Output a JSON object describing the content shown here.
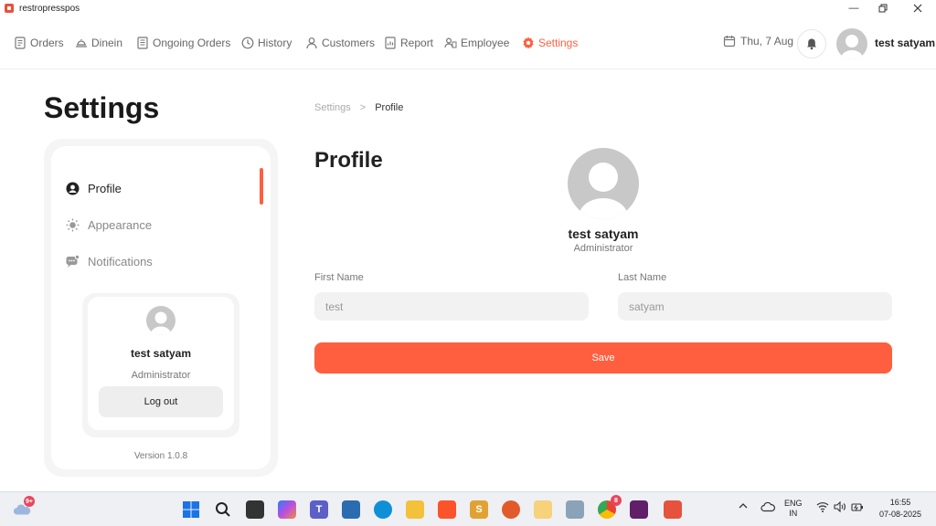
{
  "window": {
    "title": "restropresspos"
  },
  "nav": {
    "items": [
      {
        "label": "Orders",
        "icon": "orders-icon"
      },
      {
        "label": "Dinein",
        "icon": "dinein-icon"
      },
      {
        "label": "Ongoing Orders",
        "icon": "ongoing-orders-icon"
      },
      {
        "label": "History",
        "icon": "history-icon"
      },
      {
        "label": "Customers",
        "icon": "customers-icon"
      },
      {
        "label": "Report",
        "icon": "report-icon"
      },
      {
        "label": "Employee",
        "icon": "employee-icon"
      },
      {
        "label": "Settings",
        "icon": "gear-icon",
        "active": true
      }
    ],
    "date": "Thu, 7 Aug",
    "username": "test satyam"
  },
  "page": {
    "title": "Settings",
    "breadcrumb": {
      "parent": "Settings",
      "separator": ">",
      "current": "Profile"
    }
  },
  "sidebar": {
    "items": [
      {
        "label": "Profile",
        "icon": "user-circle-icon",
        "active": true
      },
      {
        "label": "Appearance",
        "icon": "sun-icon"
      },
      {
        "label": "Notifications",
        "icon": "notification-chat-icon"
      }
    ],
    "user_card": {
      "name": "test satyam",
      "role": "Administrator",
      "logout_label": "Log out"
    },
    "version": "Version 1.0.8"
  },
  "profile": {
    "heading": "Profile",
    "name": "test satyam",
    "role": "Administrator",
    "first_name_label": "First Name",
    "first_name_value": "test",
    "last_name_label": "Last Name",
    "last_name_value": "satyam",
    "save_label": "Save"
  },
  "taskbar": {
    "weather_badge": "9+",
    "chrome_badge": "8",
    "lang_top": "ENG",
    "lang_bottom": "IN",
    "time": "16:55",
    "date": "07-08-2025"
  },
  "colors": {
    "accent": "#ff5f3f",
    "avatar": "#c8c8c8"
  }
}
